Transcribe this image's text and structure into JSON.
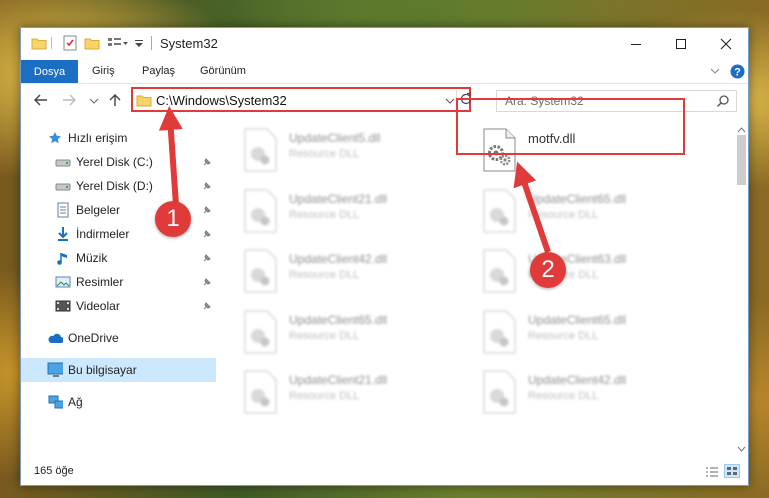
{
  "window": {
    "title": "System32"
  },
  "ribbon": {
    "tabs": [
      "Dosya",
      "Giriş",
      "Paylaş",
      "Görünüm"
    ]
  },
  "address": {
    "path": "C:\\Windows\\System32"
  },
  "search": {
    "placeholder": "Ara: System32"
  },
  "nav": {
    "items": [
      {
        "label": "Hızlı erişim",
        "icon": "star-icon"
      },
      {
        "label": "Yerel Disk (C:)",
        "icon": "drive-icon",
        "pinned": true
      },
      {
        "label": "Yerel Disk (D:)",
        "icon": "drive-icon",
        "pinned": true
      },
      {
        "label": "Belgeler",
        "icon": "document-icon",
        "pinned": true
      },
      {
        "label": "İndirmeler",
        "icon": "download-icon",
        "pinned": true
      },
      {
        "label": "Müzik",
        "icon": "music-icon",
        "pinned": true
      },
      {
        "label": "Resimler",
        "icon": "pictures-icon",
        "pinned": true
      },
      {
        "label": "Videolar",
        "icon": "video-icon",
        "pinned": true
      },
      {
        "label": "OneDrive",
        "icon": "cloud-icon"
      },
      {
        "label": "Bu bilgisayar",
        "icon": "computer-icon",
        "selected": true
      },
      {
        "label": "Ağ",
        "icon": "network-icon"
      }
    ]
  },
  "files": [
    {
      "name": "UpdateClient5.dll",
      "type": "Resource DLL"
    },
    {
      "name": "motfv.dll",
      "type": ""
    },
    {
      "name": "UpdateClient21.dll",
      "type": "Resource DLL"
    },
    {
      "name": "UpdateClient65.dll",
      "type": "Resource DLL"
    },
    {
      "name": "UpdateClient42.dll",
      "type": "Resource DLL"
    },
    {
      "name": "UpdateClient63.dll",
      "type": "Resource DLL"
    },
    {
      "name": "UpdateClient65.dll",
      "type": "Resource DLL"
    },
    {
      "name": "UpdateClient65.dll",
      "type": "Resource DLL"
    },
    {
      "name": "UpdateClient21.dll",
      "type": "Resource DLL"
    },
    {
      "name": "UpdateClient42.dll",
      "type": "Resource DLL"
    }
  ],
  "status": {
    "count": "165 öğe"
  },
  "annotations": {
    "step1": "1",
    "step2": "2"
  },
  "colors": {
    "accent": "#1a6fc4",
    "highlight_red": "#e03a3a",
    "selection": "#cce8ff"
  }
}
